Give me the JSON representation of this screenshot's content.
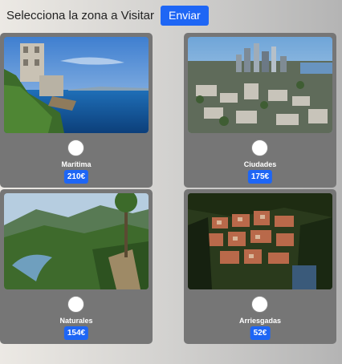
{
  "header": {
    "title": "Selecciona la zona a Visitar",
    "send_label": "Enviar"
  },
  "zones": [
    {
      "label": "Marítima",
      "price": "210€"
    },
    {
      "label": "Ciudades",
      "price": "175€"
    },
    {
      "label": "Naturales",
      "price": "154€"
    },
    {
      "label": "Arriesgadas",
      "price": "52€"
    }
  ],
  "colors": {
    "accent": "#1e66f5",
    "card": "#767676"
  }
}
